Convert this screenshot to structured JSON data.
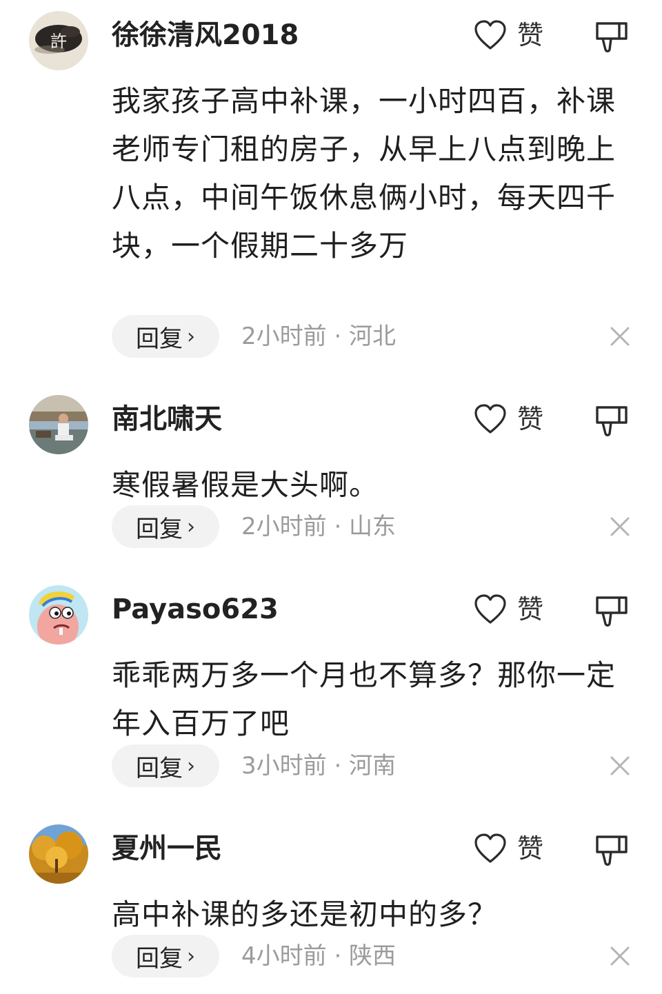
{
  "comments": [
    {
      "username": "徐徐清风2018",
      "text": "我家孩子高中补课，一小时四百，补课老师专门租的房子，从早上八点到晚上八点，中间午饭休息俩小时，每天四千块，一个假期二十多万",
      "like_label": "赞",
      "reply_label": "回复",
      "reply_chevron": "›",
      "time_location": "2小时前 · 河北",
      "avatar_glyph": "許"
    },
    {
      "username": "南北啸天",
      "text": "寒假暑假是大头啊。",
      "like_label": "赞",
      "reply_label": "回复",
      "reply_chevron": "›",
      "time_location": "2小时前 · 山东"
    },
    {
      "username": "Payaso623",
      "text": "乖乖两万多一个月也不算多？那你一定年入百万了吧",
      "like_label": "赞",
      "reply_label": "回复",
      "reply_chevron": "›",
      "time_location": "3小时前 · 河南"
    },
    {
      "username": "夏州一民",
      "text": "高中补课的多还是初中的多？",
      "like_label": "赞",
      "reply_label": "回复",
      "reply_chevron": "›",
      "time_location": "4小时前 · 陕西"
    }
  ],
  "icons": {
    "like": "heart-outline-icon",
    "dislike": "thumbs-down-icon",
    "close": "close-icon"
  },
  "colors": {
    "text": "#1f1f1f",
    "meta": "#9b9b9b",
    "reply_bg": "#f2f2f2"
  }
}
